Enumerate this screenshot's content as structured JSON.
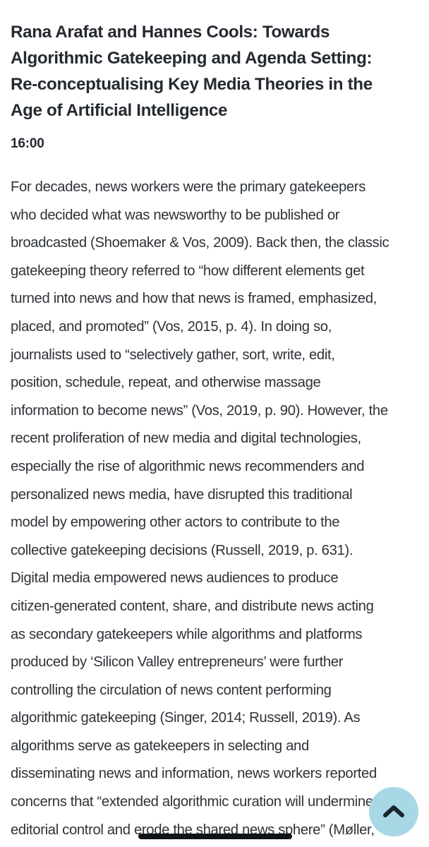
{
  "article": {
    "title": "Rana Arafat and Hannes Cools: Towards Algorithmic Gatekeeping and Agenda Setting: Re-conceptualising Key Media Theories in the Age of Artificial Intelligence",
    "title_lines": [
      "Rana Arafat and Hannes Cools: Towards",
      "Algorithmic Gatekeeping and Agenda Setting:",
      "Re-conceptualising Key Media Theories in the",
      "Age of Artificial Intelligence"
    ],
    "time": "16:00",
    "body_lines": [
      "For decades, news workers were the primary gatekeepers",
      "who decided what was newsworthy to be published or",
      "broadcasted (Shoemaker & Vos, 2009). Back then, the classic",
      "gatekeeping theory referred to “how different elements get",
      "turned into news and how that news is framed, emphasized,",
      "placed, and promoted” (Vos, 2015, p. 4). In doing so,",
      "journalists used to “selectively gather, sort, write, edit,",
      "position, schedule, repeat, and otherwise massage",
      "information to become news” (Vos, 2019, p. 90). However, the",
      "recent proliferation of new media and digital technologies,",
      "especially the rise of algorithmic news recommenders and",
      "personalized news media, have disrupted this traditional",
      "model by empowering other actors to contribute to the",
      "collective gatekeeping decisions (Russell, 2019, p. 631).",
      "Digital media empowered news audiences to produce",
      "citizen-generated content, share, and distribute news acting",
      "as secondary gatekeepers while algorithms and platforms",
      "produced by ‘Silicon Valley entrepreneurs’ were further",
      "controlling the circulation of news content performing",
      "algorithmic gatekeeping (Singer, 2014; Russell, 2019). As",
      "algorithms serve as gatekeepers in selecting and",
      "disseminating news and information, news workers reported",
      "concerns that “extended algorithmic curation will undermine",
      "editorial control and erode the shared news sphere” (Møller,"
    ]
  },
  "scroll_top_button": {
    "icon": "chevron-up-icon",
    "color": "#a8d8e6",
    "icon_color": "#1a232c"
  },
  "home_indicator": {
    "color": "#111417"
  }
}
